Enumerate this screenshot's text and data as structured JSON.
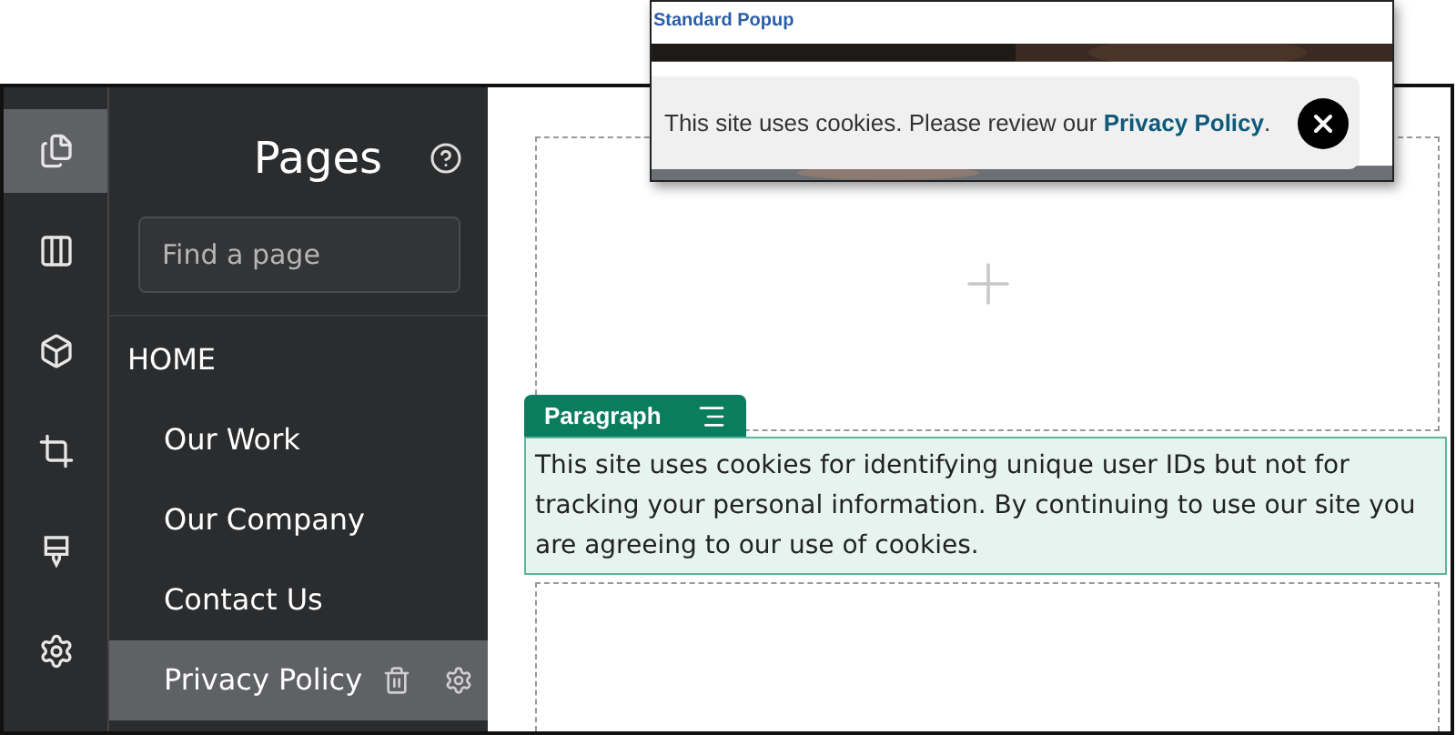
{
  "popup": {
    "title": "Standard Popup",
    "message": "This site uses cookies. Please review our",
    "link": "Privacy Policy",
    "after_link": "."
  },
  "rail": [
    {
      "kind": "pages",
      "selected": true
    },
    {
      "kind": "columns",
      "selected": false
    },
    {
      "kind": "cube",
      "selected": false
    },
    {
      "kind": "crop",
      "selected": false
    },
    {
      "kind": "brush",
      "selected": false
    },
    {
      "kind": "settings",
      "selected": false
    }
  ],
  "sidebar": {
    "title": "Pages",
    "search": {
      "placeholder": "Find a page"
    },
    "pages": [
      {
        "label": "HOME",
        "selected": false,
        "children": [
          {
            "label": "Our Work",
            "selected": false
          },
          {
            "label": "Our Company",
            "selected": false
          },
          {
            "label": "Contact Us",
            "selected": false
          },
          {
            "label": "Privacy Policy",
            "selected": true
          }
        ]
      }
    ]
  },
  "canvas": {
    "paragraph": {
      "label": "Paragraph",
      "text": "This site uses cookies for identifying unique user IDs but not for tracking your personal information. By continuing to use our site you are agreeing to our use of cookies."
    }
  }
}
